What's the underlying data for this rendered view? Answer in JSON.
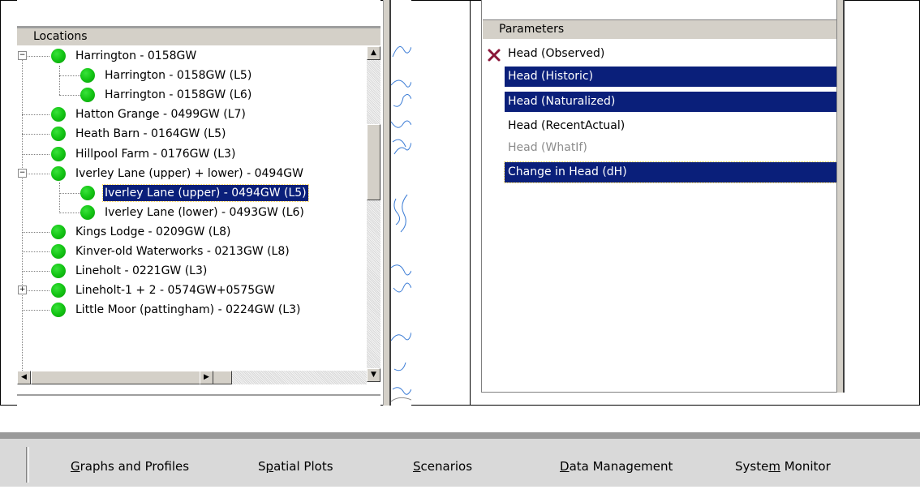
{
  "locations": {
    "header": "Locations",
    "items": [
      {
        "label": "Harrington - 0158GW",
        "level": 0,
        "expander": "minus"
      },
      {
        "label": "Harrington - 0158GW (L5)",
        "level": 1
      },
      {
        "label": "Harrington - 0158GW (L6)",
        "level": 1
      },
      {
        "label": "Hatton Grange - 0499GW (L7)",
        "level": 0
      },
      {
        "label": "Heath Barn - 0164GW (L5)",
        "level": 0
      },
      {
        "label": "Hillpool Farm - 0176GW (L3)",
        "level": 0
      },
      {
        "label": "Iverley Lane (upper) + lower) - 0494GW",
        "level": 0,
        "expander": "minus"
      },
      {
        "label": "Iverley Lane (upper) - 0494GW (L5)",
        "level": 1,
        "selected": true
      },
      {
        "label": "Iverley Lane (lower) - 0493GW (L6)",
        "level": 1
      },
      {
        "label": "Kings Lodge - 0209GW (L8)",
        "level": 0
      },
      {
        "label": "Kinver-old Waterworks - 0213GW (L8)",
        "level": 0
      },
      {
        "label": "Lineholt - 0221GW (L3)",
        "level": 0
      },
      {
        "label": "Lineholt-1 + 2 - 0574GW+0575GW",
        "level": 0,
        "expander": "plus"
      },
      {
        "label": "Little Moor (pattingham) - 0224GW (L3)",
        "level": 0
      }
    ],
    "status_color": "#13c414",
    "selection_color": "#0a1f7a"
  },
  "parameters": {
    "header": "Parameters",
    "items": [
      {
        "label": "Head (Observed)",
        "state": "normal",
        "icon": "x-mark-icon"
      },
      {
        "label": "Head (Historic)",
        "state": "selected"
      },
      {
        "label": "Head (Naturalized)",
        "state": "selected"
      },
      {
        "label": "Head (RecentActual)",
        "state": "normal"
      },
      {
        "label": "Head (WhatIf)",
        "state": "disabled"
      },
      {
        "label": "Change in Head (dH)",
        "state": "selected"
      }
    ]
  },
  "toolbar": {
    "tabs": [
      {
        "mnemonic": "G",
        "rest": "raphs and Profiles",
        "pre": ""
      },
      {
        "pre": "S",
        "mnemonic": "p",
        "rest": "atial Plots"
      },
      {
        "pre": "",
        "mnemonic": "S",
        "rest": "cenarios"
      },
      {
        "pre": "",
        "mnemonic": "D",
        "rest": "ata Management"
      },
      {
        "pre": "Syste",
        "mnemonic": "m",
        "rest": " Monitor"
      }
    ]
  }
}
